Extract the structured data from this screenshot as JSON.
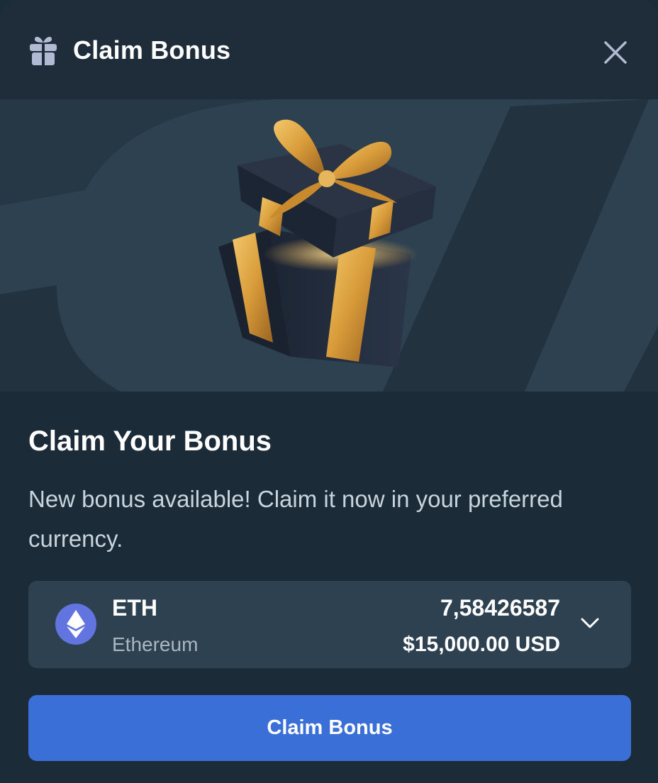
{
  "header": {
    "title": "Claim Bonus",
    "icon": "gift-icon",
    "close_icon": "close-icon"
  },
  "banner": {
    "image": "gift-box-illustration"
  },
  "content": {
    "title": "Claim Your Bonus",
    "description": "New bonus available! Claim it now in your preferred currency."
  },
  "currency": {
    "code": "ETH",
    "name": "Ethereum",
    "amount": "7,58426587",
    "usd_value": "$15,000.00 USD",
    "icon": "ethereum-icon",
    "dropdown_icon": "chevron-down-icon"
  },
  "action": {
    "label": "Claim Bonus"
  },
  "colors": {
    "background": "#1b2b37",
    "banner": "#263845",
    "select_bg": "#2e4150",
    "button": "#3b6fd8",
    "eth_icon": "#6274e0"
  }
}
